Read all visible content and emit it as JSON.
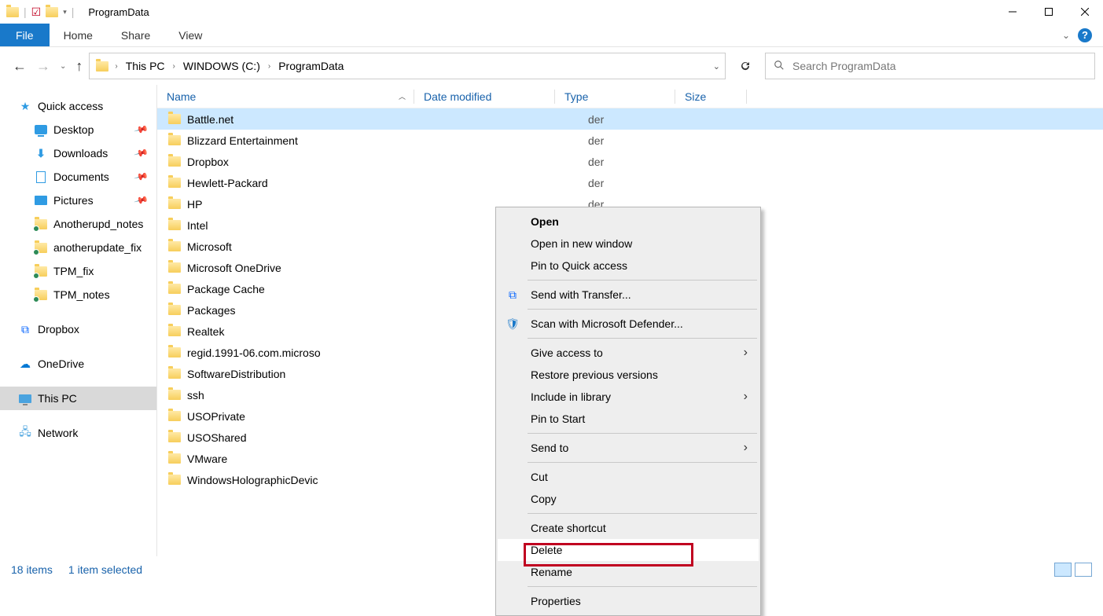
{
  "window": {
    "title": "ProgramData"
  },
  "ribbon": {
    "file": "File",
    "tabs": [
      "Home",
      "Share",
      "View"
    ]
  },
  "breadcrumbs": [
    "This PC",
    "WINDOWS (C:)",
    "ProgramData"
  ],
  "search": {
    "placeholder": "Search ProgramData"
  },
  "sidebar": {
    "quick_access": "Quick access",
    "pinned": [
      {
        "label": "Desktop",
        "icon": "desktop"
      },
      {
        "label": "Downloads",
        "icon": "downloads"
      },
      {
        "label": "Documents",
        "icon": "documents"
      },
      {
        "label": "Pictures",
        "icon": "pictures"
      }
    ],
    "recent": [
      {
        "label": "Anotherupd_notes"
      },
      {
        "label": "anotherupdate_fix"
      },
      {
        "label": "TPM_fix"
      },
      {
        "label": "TPM_notes"
      }
    ],
    "dropbox": "Dropbox",
    "onedrive": "OneDrive",
    "thispc": "This PC",
    "network": "Network"
  },
  "columns": {
    "name": "Name",
    "date": "Date modified",
    "type": "Type",
    "size": "Size"
  },
  "type_suffix": "der",
  "files": [
    {
      "name": "Battle.net",
      "selected": true
    },
    {
      "name": "Blizzard Entertainment"
    },
    {
      "name": "Dropbox"
    },
    {
      "name": "Hewlett-Packard"
    },
    {
      "name": "HP"
    },
    {
      "name": "Intel"
    },
    {
      "name": "Microsoft"
    },
    {
      "name": "Microsoft OneDrive"
    },
    {
      "name": "Package Cache"
    },
    {
      "name": "Packages"
    },
    {
      "name": "Realtek"
    },
    {
      "name": "regid.1991-06.com.microso"
    },
    {
      "name": "SoftwareDistribution"
    },
    {
      "name": "ssh"
    },
    {
      "name": "USOPrivate"
    },
    {
      "name": "USOShared"
    },
    {
      "name": "VMware"
    },
    {
      "name": "WindowsHolographicDevic"
    }
  ],
  "context_menu": {
    "open": "Open",
    "open_new_window": "Open in new window",
    "pin_quick": "Pin to Quick access",
    "send_transfer": "Send with Transfer...",
    "scan_defender": "Scan with Microsoft Defender...",
    "give_access": "Give access to",
    "restore": "Restore previous versions",
    "include_library": "Include in library",
    "pin_start": "Pin to Start",
    "send_to": "Send to",
    "cut": "Cut",
    "copy": "Copy",
    "create_shortcut": "Create shortcut",
    "delete": "Delete",
    "rename": "Rename",
    "properties": "Properties"
  },
  "status": {
    "items": "18 items",
    "selected": "1 item selected"
  }
}
